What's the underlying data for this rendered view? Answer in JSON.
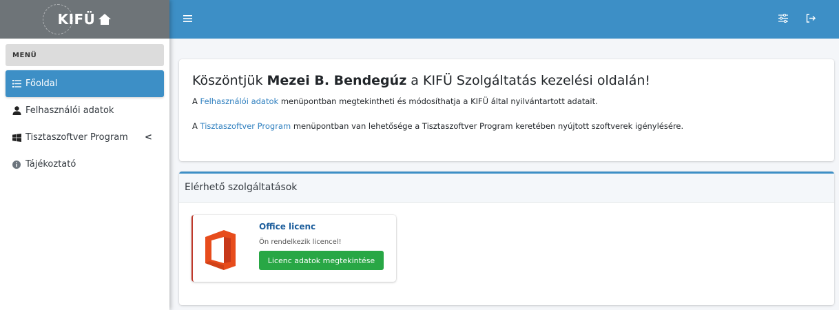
{
  "brand": {
    "name": "KIFÜ"
  },
  "sidebar": {
    "menu_header": "MENÜ",
    "items": [
      {
        "label": "Főoldal",
        "icon": "list-icon",
        "active": true
      },
      {
        "label": "Felhasználói adatok",
        "icon": "user-icon"
      },
      {
        "label": "Tisztaszoftver Program",
        "icon": "windows-icon",
        "chevron": "<"
      },
      {
        "label": "Tájékoztató",
        "icon": "info-icon"
      }
    ]
  },
  "topbar": {
    "menu_icon": "hamburger-icon",
    "settings_icon": "sliders-icon",
    "logout_icon": "logout-icon"
  },
  "welcome": {
    "title_prefix": "Köszöntjük",
    "user_name": "Mezei B. Bendegúz",
    "title_suffix": "a KIFÜ Szolgáltatás kezelési oldalán!",
    "line1_pre": "A",
    "line1_link": "Felhasználói adatok",
    "line1_post": "menüpontban megtekintheti és módosíthatja a KIFÜ által nyilvántartott adatait.",
    "line2_pre": "A",
    "line2_link": "Tisztaszoftver Program",
    "line2_post": "menüpontban van lehetősége a Tisztaszoftver Program keretében nyújtott szoftverek igénylésére."
  },
  "services": {
    "header": "Elérhető szolgáltatások",
    "items": [
      {
        "title": "Office licenc",
        "status": "Ön rendelkezik licencel!",
        "button": "Licenc adatok megtekintése",
        "icon": "office-icon"
      }
    ]
  },
  "colors": {
    "primary": "#3d8fc6",
    "success": "#28a745",
    "office": "#e74c1c"
  }
}
